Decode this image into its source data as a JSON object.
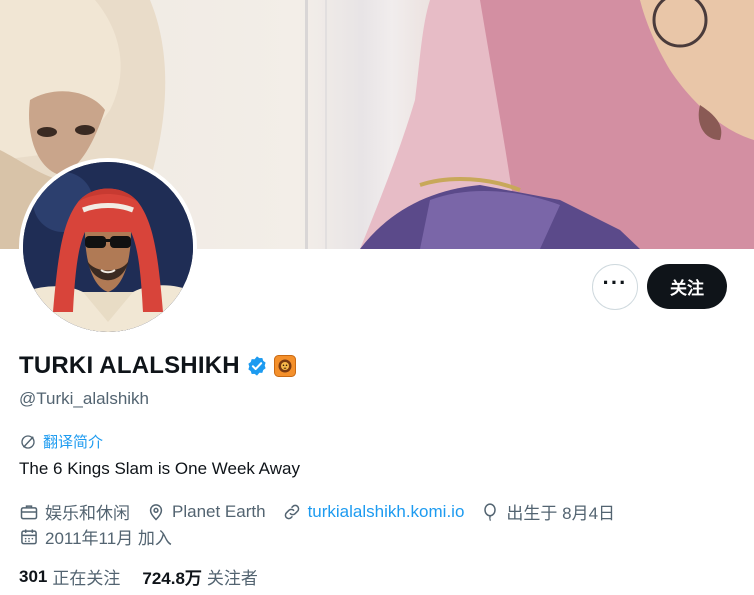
{
  "profile": {
    "display_name": "TURKI ALALSHIKH",
    "handle": "@Turki_alalshikh",
    "translate_label": "翻译简介",
    "bio": "The 6 Kings Slam is One Week Away",
    "category": "娱乐和休闲",
    "location": "Planet Earth",
    "website": "turkialalshikh.komi.io",
    "birthday": "出生于 8月4日",
    "joined": "2011年11月 加入"
  },
  "actions": {
    "more_label": "···",
    "follow_label": "关注"
  },
  "stats": {
    "following_count": "301",
    "following_label": "正在关注",
    "followers_count": "724.8万",
    "followers_label": "关注者"
  },
  "colors": {
    "accent": "#1d9bf0",
    "text_primary": "#0f1419",
    "text_secondary": "#536471",
    "follow_button": "#0f1419",
    "badge": "#f4902b"
  },
  "icons": {
    "verified": "verified-badge-icon",
    "affiliation": "lion-badge-icon",
    "translate": "translate-icon",
    "category": "briefcase-icon",
    "location": "location-pin-icon",
    "website": "link-icon",
    "birthday": "balloon-icon",
    "joined": "calendar-icon"
  }
}
